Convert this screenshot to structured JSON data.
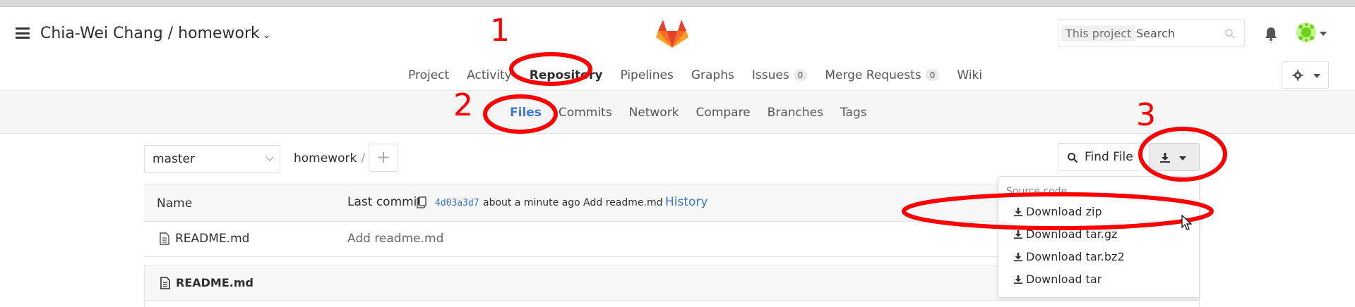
{
  "header": {
    "project_title": "Chia-Wei Chang / homework",
    "search_scope": "This project",
    "search_placeholder": "Search"
  },
  "main_nav": [
    {
      "label": "Project"
    },
    {
      "label": "Activity"
    },
    {
      "label": "Repository",
      "active": true
    },
    {
      "label": "Pipelines"
    },
    {
      "label": "Graphs"
    },
    {
      "label": "Issues",
      "badge": "0"
    },
    {
      "label": "Merge Requests",
      "badge": "0"
    },
    {
      "label": "Wiki"
    }
  ],
  "sub_nav": [
    {
      "label": "Files",
      "active": true
    },
    {
      "label": "Commits"
    },
    {
      "label": "Network"
    },
    {
      "label": "Compare"
    },
    {
      "label": "Branches"
    },
    {
      "label": "Tags"
    }
  ],
  "toolbar": {
    "branch": "master",
    "breadcrumb_root": "homework",
    "breadcrumb_sep": "/",
    "add_label": "+",
    "find_file_label": "Find File"
  },
  "table": {
    "name_header": "Name",
    "last_commit_label": "Last commit",
    "commit_sha": "4d03a3d7",
    "commit_time_message": "about a minute ago Add readme.md",
    "history_label": "History",
    "rows": [
      {
        "name": "README.md",
        "message": "Add readme.md"
      }
    ]
  },
  "readme": {
    "title": "README.md"
  },
  "download_menu": {
    "header": "Source code",
    "items": [
      {
        "label": "Download zip"
      },
      {
        "label": "Download tar.gz"
      },
      {
        "label": "Download tar.bz2"
      },
      {
        "label": "Download tar"
      }
    ]
  },
  "annotations": {
    "step1": "1",
    "step2": "2",
    "step3": "3"
  },
  "colors": {
    "annotation": "#ff0000",
    "link": "#3777c5",
    "active_tab": "#4a86d6"
  },
  "icons": [
    "hamburger-icon",
    "gitlab-logo",
    "search-icon",
    "bell-icon",
    "avatar",
    "gear-icon",
    "search-icon",
    "download-icon",
    "clipboard-icon",
    "file-icon",
    "cursor-icon"
  ]
}
